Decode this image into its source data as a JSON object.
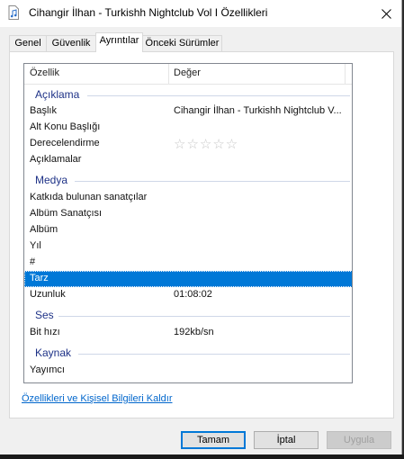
{
  "window": {
    "title": "Cihangir İlhan - Turkishh Nightclub Vol I Özellikleri"
  },
  "tabs": [
    "Genel",
    "Güvenlik",
    "Ayrıntılar",
    "Önceki Sürümler"
  ],
  "active_tab": "Ayrıntılar",
  "list": {
    "headers": {
      "property": "Özellik",
      "value": "Değer"
    },
    "groups": {
      "description": "Açıklama",
      "media": "Medya",
      "audio": "Ses",
      "source": "Kaynak"
    },
    "rows": {
      "title": {
        "k": "Başlık",
        "v": "Cihangir İlhan - Turkishh Nightclub V..."
      },
      "subtitle": {
        "k": "Alt Konu Başlığı",
        "v": ""
      },
      "rating": {
        "k": "Derecelendirme",
        "stars": "☆☆☆☆☆",
        "value": 0
      },
      "comments": {
        "k": "Açıklamalar",
        "v": ""
      },
      "contributing_artists": {
        "k": "Katkıda bulunan sanatçılar",
        "v": ""
      },
      "album_artist": {
        "k": "Albüm Sanatçısı",
        "v": ""
      },
      "album": {
        "k": "Albüm",
        "v": ""
      },
      "year": {
        "k": "Yıl",
        "v": ""
      },
      "track": {
        "k": "#",
        "v": ""
      },
      "genre": {
        "k": "Tarz",
        "v": ""
      },
      "length": {
        "k": "Uzunluk",
        "v": "01:08:02"
      },
      "bitrate": {
        "k": "Bit hızı",
        "v": "192kb/sn"
      },
      "publisher": {
        "k": "Yayımcı",
        "v": ""
      }
    },
    "selected_row": "Tarz"
  },
  "remove_link": "Özellikleri ve Kişisel Bilgileri Kaldır",
  "buttons": {
    "ok": "Tamam",
    "cancel": "İptal",
    "apply": "Uygula"
  },
  "colors": {
    "selection": "#0078d7",
    "group_text": "#1e3287",
    "link": "#0066cc"
  }
}
